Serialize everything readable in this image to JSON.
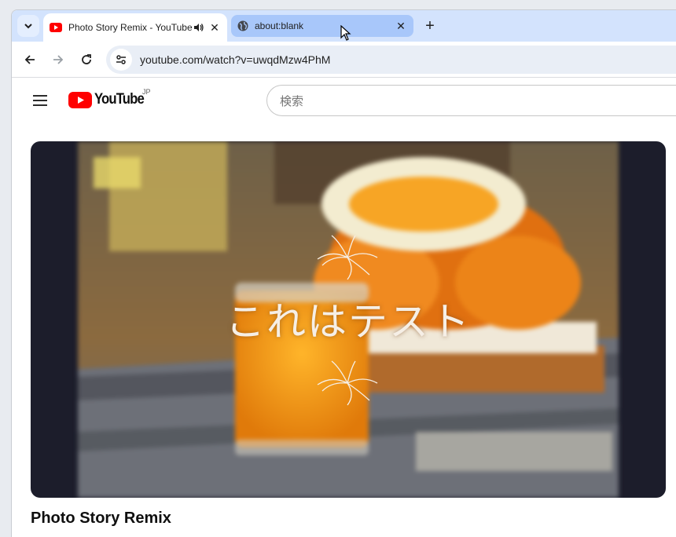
{
  "browser": {
    "tabs": [
      {
        "title": "Photo Story Remix - YouTube",
        "favicon": "youtube-favicon-icon",
        "audio": "speaker-icon",
        "active": true
      },
      {
        "title": "about:blank",
        "favicon": "globe-icon",
        "active": false
      }
    ],
    "url": "youtube.com/watch?v=uwqdMzw4PhM",
    "colors": {
      "tabstrip": "#d3e3fd",
      "active_tab": "#ffffff",
      "inactive_tab": "#a8c7fa",
      "omnibox": "#e9eef6"
    }
  },
  "youtube": {
    "logo_text": "YouTube",
    "region": "JP",
    "search_placeholder": "検索",
    "brand_color": "#ff0000"
  },
  "video": {
    "overlay_text": "これはテスト",
    "title": "Photo Story Remix"
  }
}
